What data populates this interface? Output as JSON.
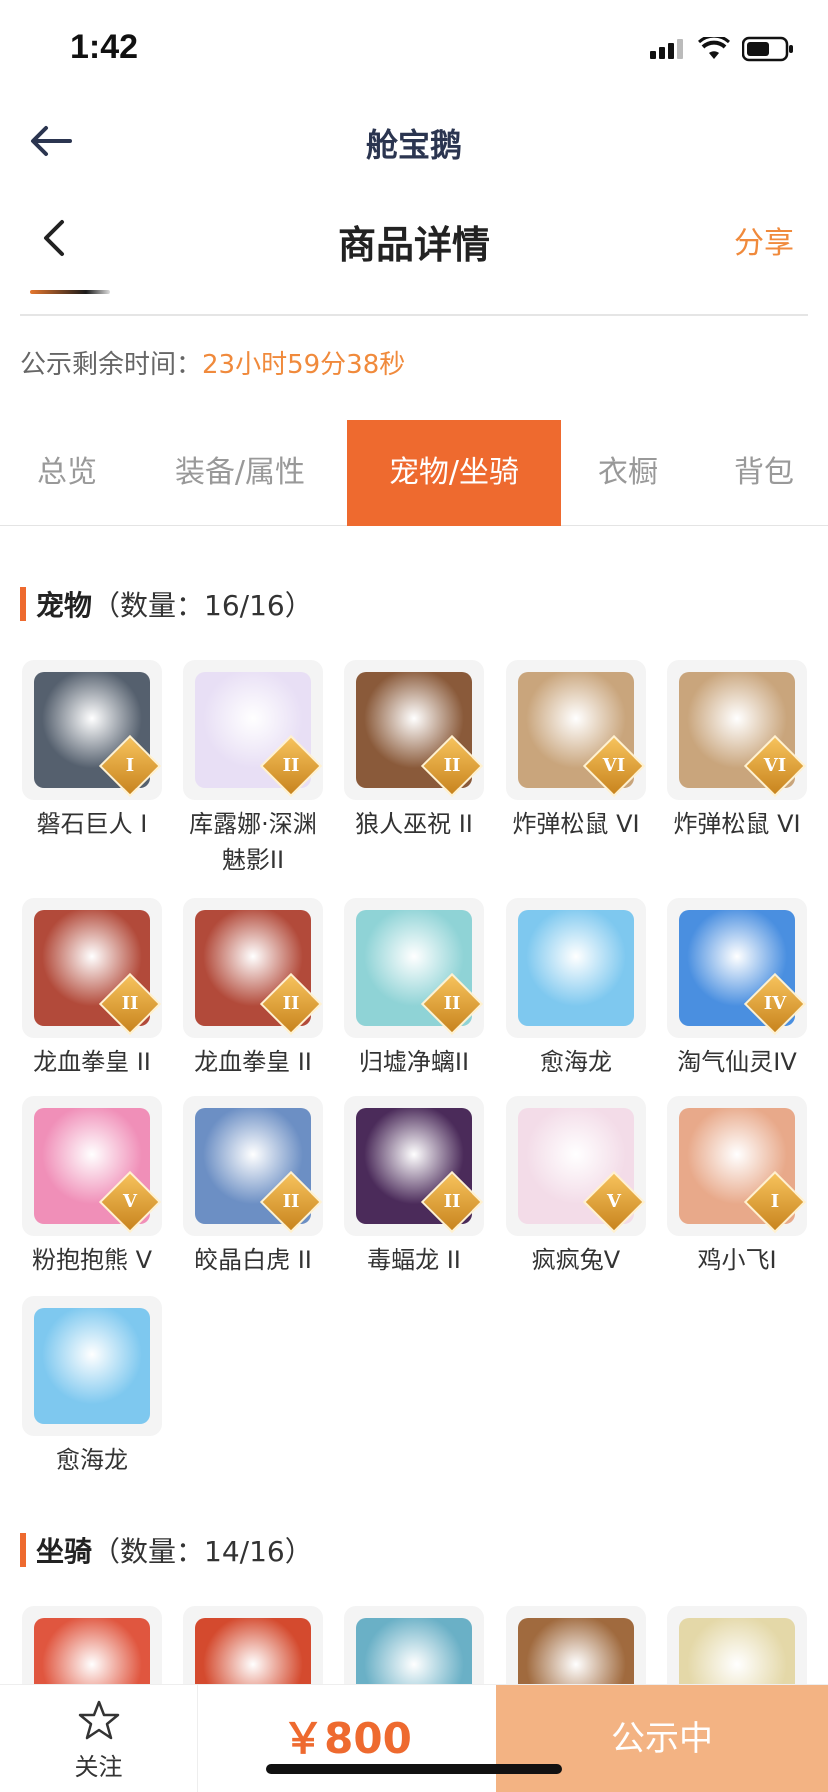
{
  "status_bar": {
    "time": "1:42"
  },
  "app_bar": {
    "title": "舱宝鹅"
  },
  "nav": {
    "title": "商品详情",
    "share": "分享"
  },
  "countdown": {
    "label": "公示剩余时间：",
    "value": "23小时59分38秒"
  },
  "tabs": [
    {
      "label": "总览",
      "active": false
    },
    {
      "label": "装备/属性",
      "active": false
    },
    {
      "label": "宠物/坐骑",
      "active": true
    },
    {
      "label": "衣橱",
      "active": false
    },
    {
      "label": "背包",
      "active": false
    }
  ],
  "pets": {
    "title": "宠物",
    "count": "（数量：16/16）",
    "items": [
      {
        "name": "磐石巨人 I",
        "badge": "I",
        "color": "#55606e"
      },
      {
        "name": "库露娜·深渊魅影II",
        "badge": "II",
        "color": "#e8dff5"
      },
      {
        "name": "狼人巫祝 II",
        "badge": "II",
        "color": "#8a5a3a"
      },
      {
        "name": "炸弹松鼠 VI",
        "badge": "VI",
        "color": "#c9a57c"
      },
      {
        "name": "炸弹松鼠 VI",
        "badge": "VI",
        "color": "#c9a57c"
      },
      {
        "name": "龙血拳皇 II",
        "badge": "II",
        "color": "#b24a3a"
      },
      {
        "name": "龙血拳皇 II",
        "badge": "II",
        "color": "#b24a3a"
      },
      {
        "name": "归墟净螭II",
        "badge": "II",
        "color": "#8fd3d6"
      },
      {
        "name": "愈海龙",
        "badge": "",
        "color": "#7ec8ef"
      },
      {
        "name": "淘气仙灵IV",
        "badge": "IV",
        "color": "#4a8fe0"
      },
      {
        "name": "粉抱抱熊 V",
        "badge": "V",
        "color": "#f08fb8"
      },
      {
        "name": "皎晶白虎 II",
        "badge": "II",
        "color": "#6c8fc4"
      },
      {
        "name": "毒蝠龙 II",
        "badge": "II",
        "color": "#4b2b5a"
      },
      {
        "name": "疯疯兔V",
        "badge": "V",
        "color": "#f3dce8"
      },
      {
        "name": "鸡小飞I",
        "badge": "I",
        "color": "#e8a98a"
      },
      {
        "name": "愈海龙",
        "badge": "",
        "color": "#7ec8ef"
      }
    ]
  },
  "mounts": {
    "title": "坐骑",
    "count": "（数量：14/16）",
    "items": [
      {
        "color": "#e0563f"
      },
      {
        "color": "#d44a2e"
      },
      {
        "color": "#6ab0c6"
      },
      {
        "color": "#a06a3e"
      },
      {
        "color": "#e4d8a8"
      }
    ]
  },
  "bottom_bar": {
    "follow": "关注",
    "price": "￥800",
    "status": "公示中"
  },
  "colors": {
    "accent": "#ee6a2f",
    "orange_text": "#f08a3c",
    "status_button": "#f3b383"
  }
}
